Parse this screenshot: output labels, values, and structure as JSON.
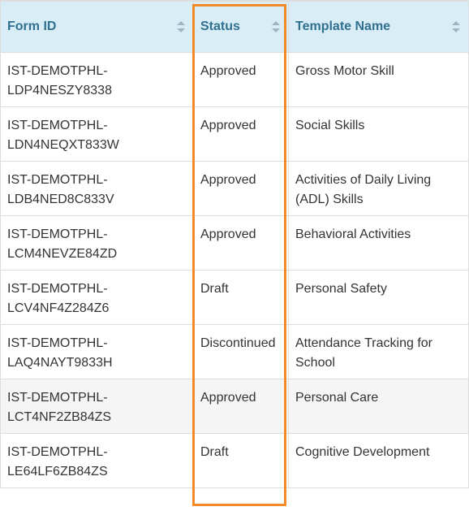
{
  "table": {
    "columns": [
      {
        "label": "Form ID",
        "sort_icon": "sort-both-icon"
      },
      {
        "label": "Status",
        "sort_icon": "sort-both-icon"
      },
      {
        "label": "Template Name",
        "sort_icon": "sort-both-icon"
      }
    ],
    "rows": [
      {
        "form_id_line1": "IST-DEMOTPHL-",
        "form_id_line2": "LDP4NESZY8338",
        "status": "Approved",
        "template": "Gross Motor Skill"
      },
      {
        "form_id_line1": "IST-DEMOTPHL-",
        "form_id_line2": "LDN4NEQXT833W",
        "status": "Approved",
        "template": "Social Skills"
      },
      {
        "form_id_line1": "IST-DEMOTPHL-",
        "form_id_line2": "LDB4NED8C833V",
        "status": "Approved",
        "template": "Activities of Daily Living (ADL) Skills"
      },
      {
        "form_id_line1": "IST-DEMOTPHL-",
        "form_id_line2": "LCM4NEVZE84ZD",
        "status": "Approved",
        "template": "Behavioral Activities"
      },
      {
        "form_id_line1": "IST-DEMOTPHL-",
        "form_id_line2": "LCV4NF4Z284Z6",
        "status": "Draft",
        "template": "Personal Safety"
      },
      {
        "form_id_line1": "IST-DEMOTPHL-",
        "form_id_line2": "LAQ4NAYT9833H",
        "status": "Discontinued",
        "template": "Attendance Tracking for School"
      },
      {
        "form_id_line1": "IST-DEMOTPHL-",
        "form_id_line2": "LCT4NF2ZB84ZS",
        "status": "Approved",
        "template": "Personal Care"
      },
      {
        "form_id_line1": "IST-DEMOTPHL-",
        "form_id_line2": "LE64LF6ZB84ZS",
        "status": "Draft",
        "template": "Cognitive Development"
      }
    ]
  },
  "colors": {
    "header_bg": "#d9edf7",
    "header_text": "#31708f",
    "highlight": "#f38a28",
    "hover_row": "#f5f5f5"
  }
}
